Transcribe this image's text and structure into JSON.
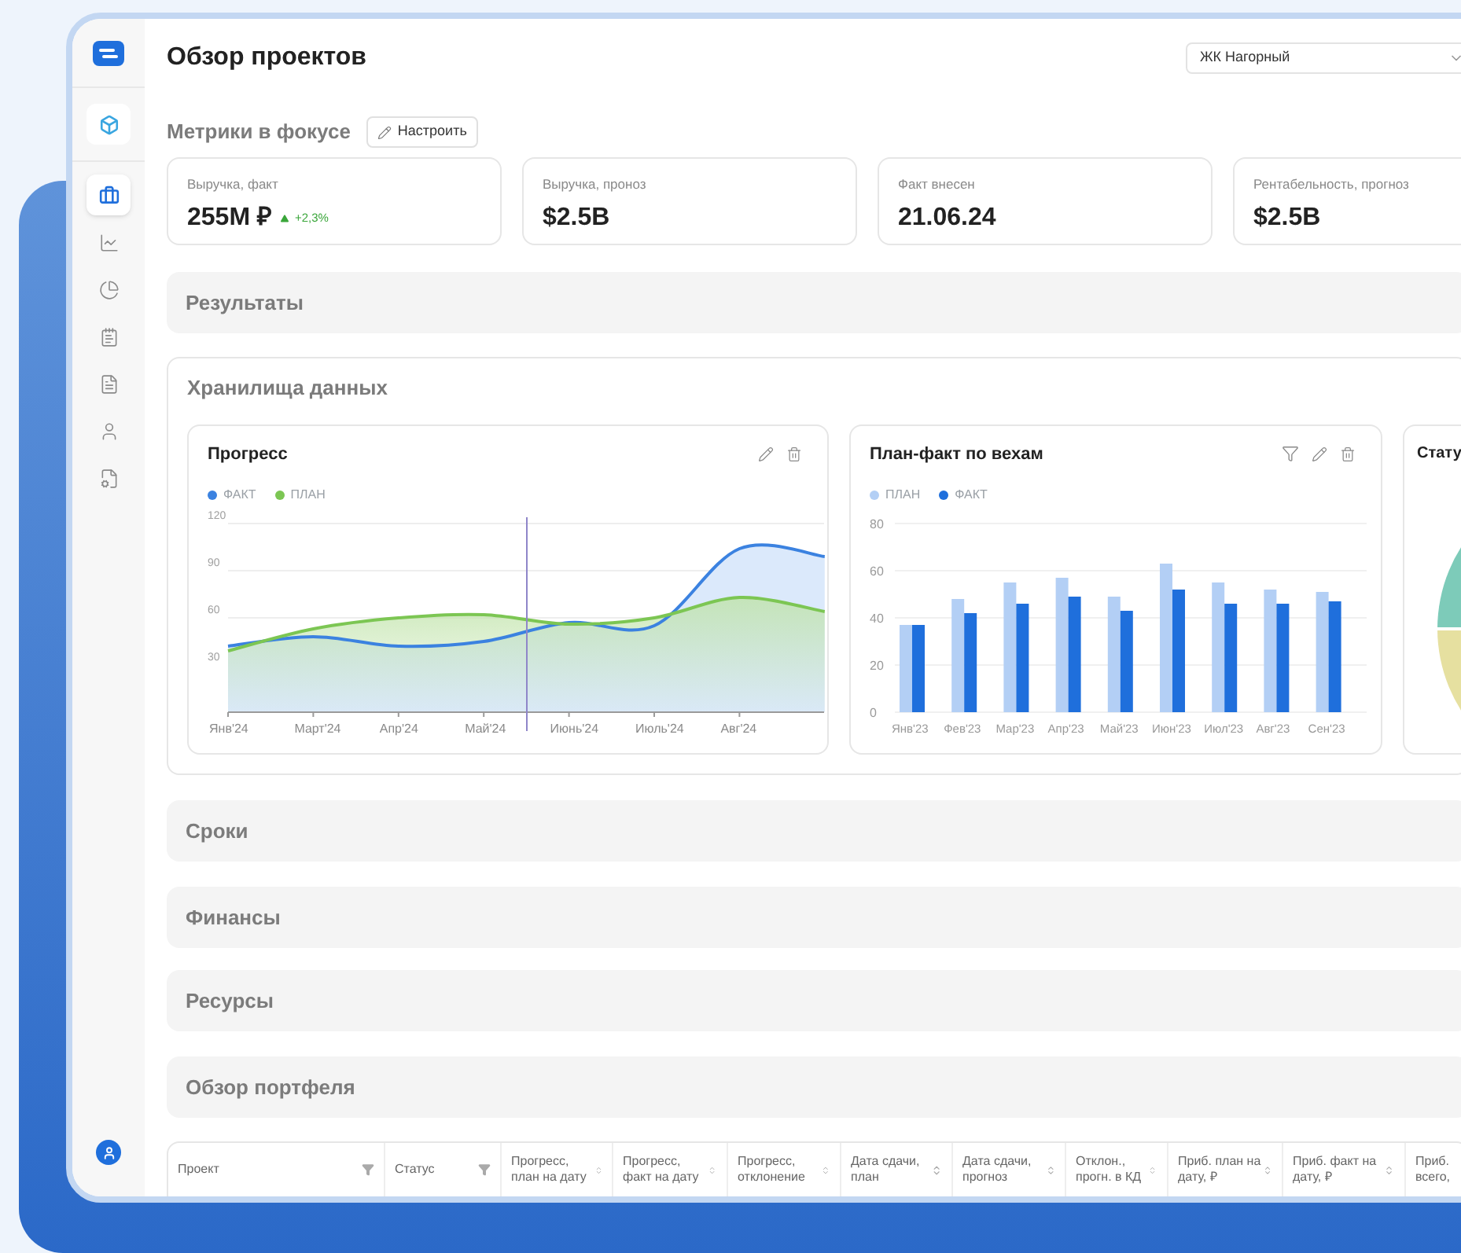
{
  "sidebar": {
    "items": [
      {
        "selected": false
      },
      {
        "selected": true
      },
      {
        "selected": false
      },
      {
        "selected": false
      },
      {
        "selected": false
      },
      {
        "selected": false
      },
      {
        "selected": false
      },
      {
        "selected": false
      }
    ]
  },
  "header": {
    "title": "Обзор проектов",
    "project_select": {
      "value": "ЖК Нагорный"
    }
  },
  "metrics": {
    "title": "Метрики в фокусе",
    "configure_button": "Настроить",
    "cards": [
      {
        "label": "Выручка, факт",
        "value": "255M ₽",
        "delta": {
          "text": "+2,3%",
          "kind": "up"
        }
      },
      {
        "label": "Выручка, проноз",
        "value": "$2.5B"
      },
      {
        "label": "Факт внесен",
        "value": "21.06.24"
      },
      {
        "label": "Рентабельность, прогноз",
        "value": "$2.5B"
      }
    ]
  },
  "sections": [
    {
      "kind": "collapsed",
      "title": "Результаты"
    },
    {
      "kind": "panel",
      "title": "Хранилища данных",
      "cards": [
        {
          "kind": "chart",
          "title": "Прогресс",
          "filterable": false,
          "chart_data": {
            "type": "area",
            "categories": [
              "Янв'24",
              "Март'24",
              "Апр'24",
              "Май'24",
              "Июнь'24",
              "Июль'24",
              "Авг'24",
              null
            ],
            "ylim": [
              0,
              120
            ],
            "yticks": [
              30,
              60,
              90,
              120
            ],
            "grid": true,
            "series": [
              {
                "name": "ФАКТ",
                "color": "#3b82e0",
                "values": [
                  42,
                  48,
                  42,
                  45,
                  57,
                  55,
                  104,
                  99
                ]
              },
              {
                "name": "ПЛАН",
                "color": "#7cc653",
                "values": [
                  39,
                  53,
                  60,
                  62,
                  56,
                  60,
                  73,
                  64
                ]
              }
            ]
          }
        },
        {
          "kind": "chart",
          "title": "План-факт по вехам",
          "filterable": true,
          "chart_data": {
            "type": "bar",
            "categories": [
              "Янв'23",
              "Фев'23",
              "Мар'23",
              "Апр'23",
              "Май'23",
              "Июн'23",
              "Июл'23",
              "Авг'23",
              "Сен'23"
            ],
            "ylim": [
              0,
              80
            ],
            "yticks": [
              0,
              20,
              40,
              60,
              80
            ],
            "grid": true,
            "series": [
              {
                "name": "ПЛАН",
                "color": "#b3cff5",
                "values": [
                  37,
                  48,
                  55,
                  57,
                  49,
                  63,
                  55,
                  52,
                  51
                ]
              },
              {
                "name": "ФАКТ",
                "color": "#1f6fdc",
                "values": [
                  37,
                  42,
                  46,
                  49,
                  43,
                  52,
                  46,
                  46,
                  47
                ]
              }
            ]
          }
        },
        {
          "kind": "pie",
          "title": "Стату"
        }
      ]
    },
    {
      "kind": "collapsed",
      "title": "Сроки"
    },
    {
      "kind": "collapsed",
      "title": "Финансы"
    },
    {
      "kind": "collapsed",
      "title": "Ресурсы"
    },
    {
      "kind": "collapsed",
      "title": "Обзор портфеля"
    }
  ],
  "table": {
    "columns": [
      {
        "label": "Проект",
        "kind": "filter"
      },
      {
        "label": "Статус",
        "kind": "filter"
      },
      {
        "label": "Прогресс, план на дату",
        "kind": "sort"
      },
      {
        "label": "Прогресс, факт на дату",
        "kind": "sort"
      },
      {
        "label": "Прогресс, отклонение",
        "kind": "sort"
      },
      {
        "label": "Дата сдачи, план",
        "kind": "sort"
      },
      {
        "label": "Дата сдачи, прогноз",
        "kind": "sort"
      },
      {
        "label": "Отклон., прогн. в КД",
        "kind": "sort"
      },
      {
        "label": "Приб. план на дату, ₽",
        "kind": "sort"
      },
      {
        "label": "Приб. факт на дату, ₽",
        "kind": "sort"
      },
      {
        "label": "Приб. всего,",
        "kind": "plain"
      }
    ]
  }
}
